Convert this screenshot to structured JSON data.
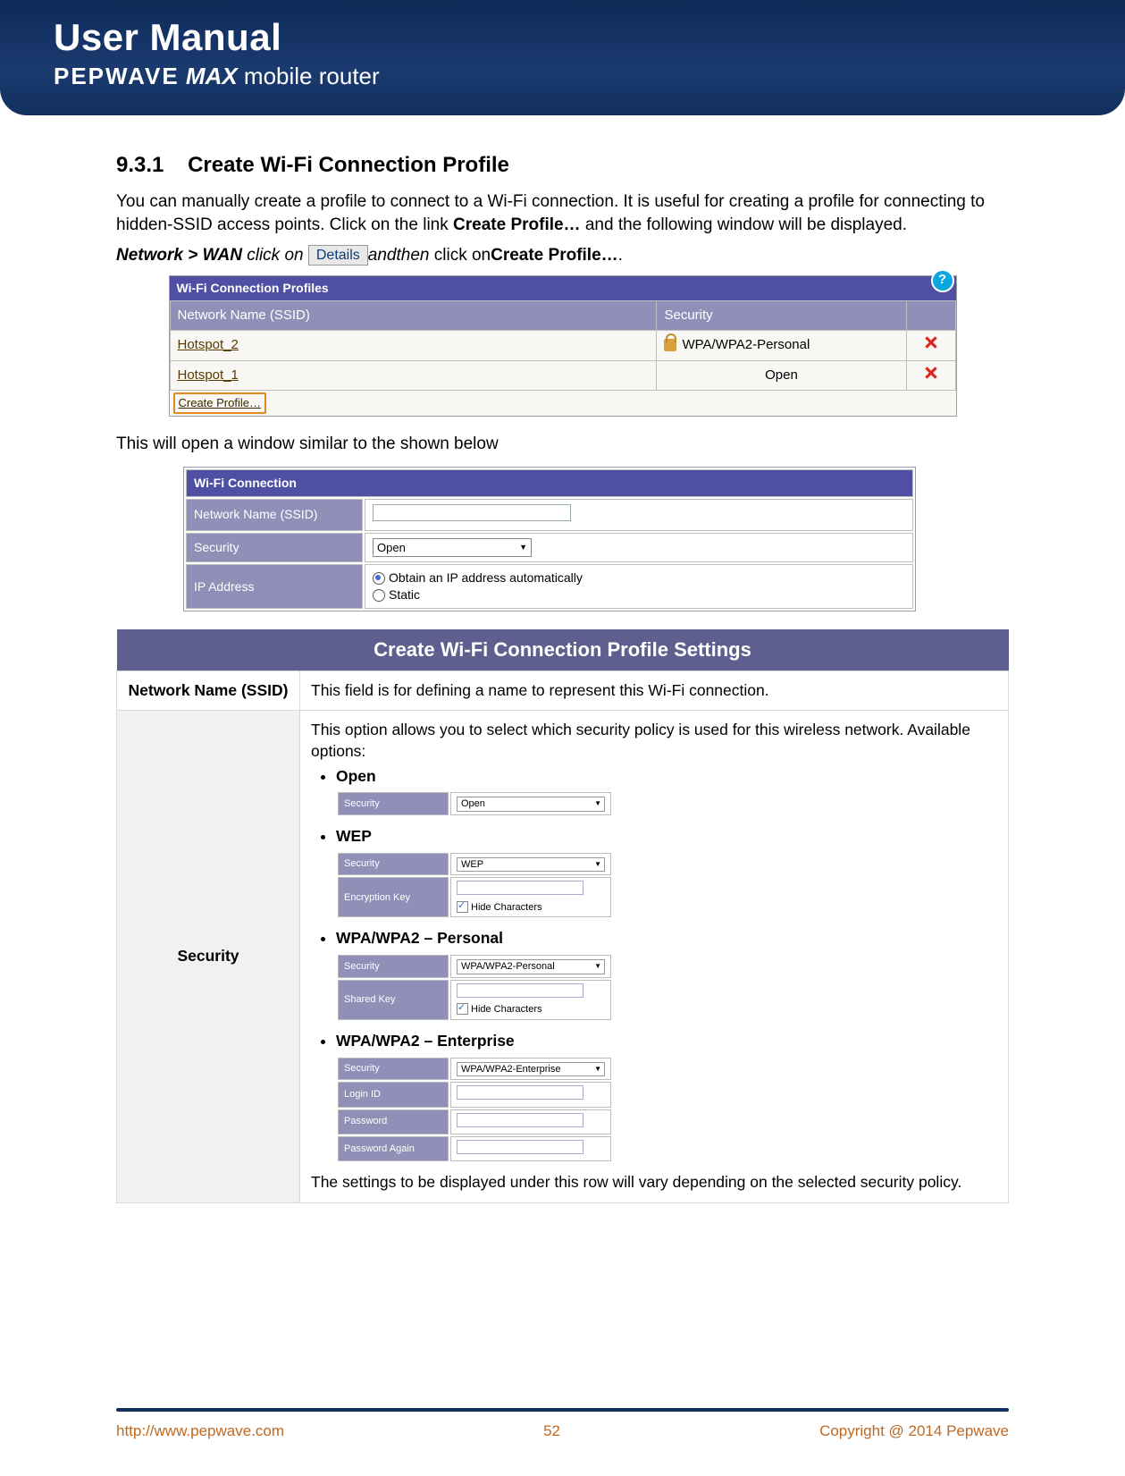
{
  "banner": {
    "title": "User Manual",
    "sub_brand": "PEPWAVE",
    "sub_model": "MAX",
    "sub_suffix": "mobile router"
  },
  "section": {
    "number": "9.3.1",
    "title": "Create Wi-Fi Connection Profile"
  },
  "intro": {
    "p1_a": "You can manually create a profile to connect to a Wi-Fi connection.  It is useful for creating a profile for connecting to hidden-SSID access points. Click on the link ",
    "p1_b": "Create Profile…",
    "p1_c": " and the following window will be displayed.",
    "nav_a": "Network > WAN",
    "nav_b": " click on",
    "details_btn": "Details",
    "nav_c": "andthen",
    "nav_d": " click on",
    "nav_e": "Create Profile…",
    "nav_f": "."
  },
  "ss1": {
    "title": "Wi-Fi Connection Profiles",
    "col1": "Network Name (SSID)",
    "col2": "Security",
    "rows": [
      {
        "ssid": "Hotspot_2",
        "security": "WPA/WPA2-Personal",
        "has_lock": true
      },
      {
        "ssid": "Hotspot_1",
        "security": "Open",
        "has_lock": false
      }
    ],
    "create_link": "Create Profile…"
  },
  "mid_text": "This will open a window similar to the shown below",
  "ss2": {
    "title": "Wi-Fi Connection",
    "ssid_label": "Network Name (SSID)",
    "sec_label": "Security",
    "sec_value": "Open",
    "ip_label": "IP Address",
    "ip_auto": "Obtain an IP address automatically",
    "ip_static": "Static"
  },
  "settings": {
    "header": "Create Wi-Fi Connection Profile Settings",
    "row1_label": "Network Name (SSID)",
    "row1_text": "This field is for defining a name to represent this Wi-Fi connection.",
    "row2_label": "Security",
    "row2_intro": "This option allows you to select which security policy is used for this wireless network. Available options:",
    "opt_open": "Open",
    "opt_wep": "WEP",
    "opt_wpa_p": "WPA/WPA2 – Personal",
    "opt_wpa_e": "WPA/WPA2 – Enterprise",
    "row2_outro": "The settings to be displayed under this row will vary depending on the selected security policy.",
    "inner": {
      "security_lbl": "Security",
      "open_val": "Open",
      "wep_val": "WEP",
      "enc_key_lbl": "Encryption Key",
      "hide_chars": "Hide Characters",
      "wpap_val": "WPA/WPA2-Personal",
      "shared_key_lbl": "Shared Key",
      "wpae_val": "WPA/WPA2-Enterprise",
      "login_lbl": "Login ID",
      "pass_lbl": "Password",
      "pass2_lbl": "Password Again"
    }
  },
  "footer": {
    "url": "http://www.pepwave.com",
    "page": "52",
    "copyright": "Copyright @ 2014 Pepwave"
  }
}
